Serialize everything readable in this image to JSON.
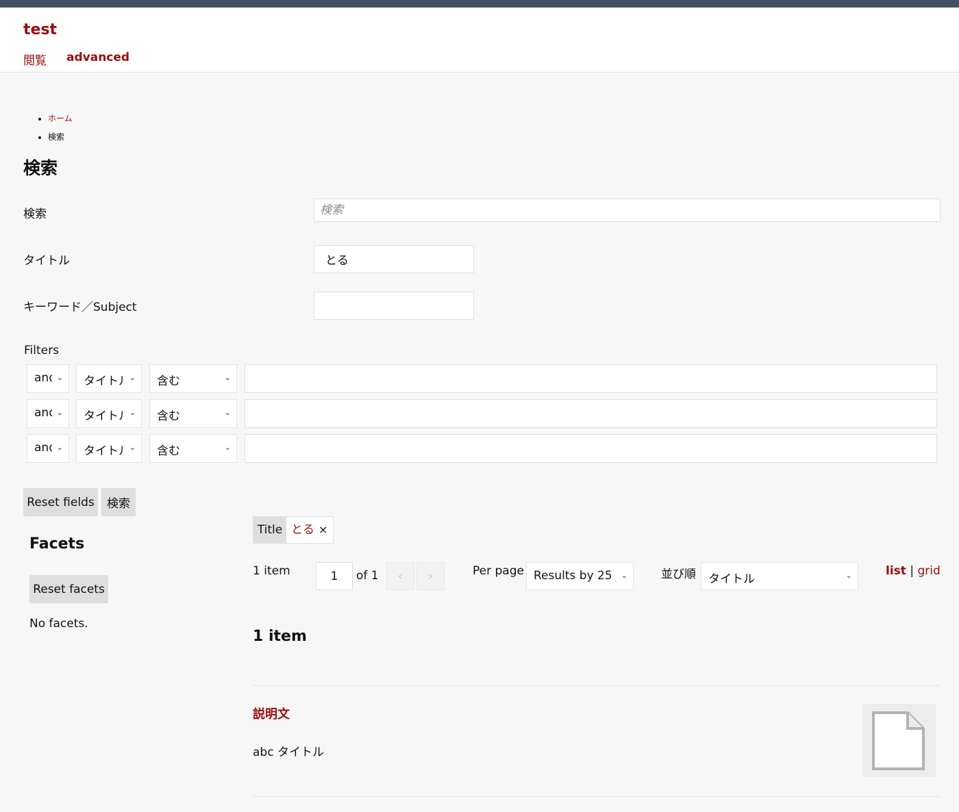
{
  "header": {
    "site_title": "test",
    "nav": {
      "browse": "閲覧",
      "advanced": "advanced"
    }
  },
  "breadcrumb": {
    "home": "ホーム",
    "current": "検索"
  },
  "page_title": "検索",
  "form": {
    "search": {
      "label": "検索",
      "placeholder": "検索",
      "value": ""
    },
    "title": {
      "label": "タイトル",
      "value": "とる"
    },
    "keyword": {
      "label": "キーワード／Subject",
      "value": ""
    },
    "filters_label": "Filters",
    "filters": [
      {
        "joiner": "and",
        "field": "タイトル",
        "operator": "含む",
        "value": ""
      },
      {
        "joiner": "and",
        "field": "タイトル",
        "operator": "含む",
        "value": ""
      },
      {
        "joiner": "and",
        "field": "タイトル",
        "operator": "含む",
        "value": ""
      }
    ],
    "reset_label": "Reset fields",
    "submit_label": "検索"
  },
  "facets": {
    "title": "Facets",
    "reset_label": "Reset facets",
    "empty_text": "No facets."
  },
  "active_filter": {
    "key": "Title",
    "value": "とる",
    "remove_symbol": "×"
  },
  "pagination": {
    "count_text": "1 item",
    "current_page": "1",
    "of_text": "of 1",
    "prev_symbol": "‹",
    "next_symbol": "›",
    "per_page_label": "Per page",
    "per_page_value": "Results by 25",
    "sort_label": "並び順",
    "sort_value": "タイトル",
    "view_list": "list",
    "view_separator": "|",
    "view_grid": "grid"
  },
  "results": {
    "heading": "1 item",
    "items": [
      {
        "title": "説明文",
        "description": "abc タイトル",
        "thumbnail_icon": "file-icon"
      }
    ]
  },
  "colors": {
    "accent": "#9a0d0d",
    "topbar": "#434f64",
    "background": "#f7f7f7",
    "button": "#dedede"
  }
}
